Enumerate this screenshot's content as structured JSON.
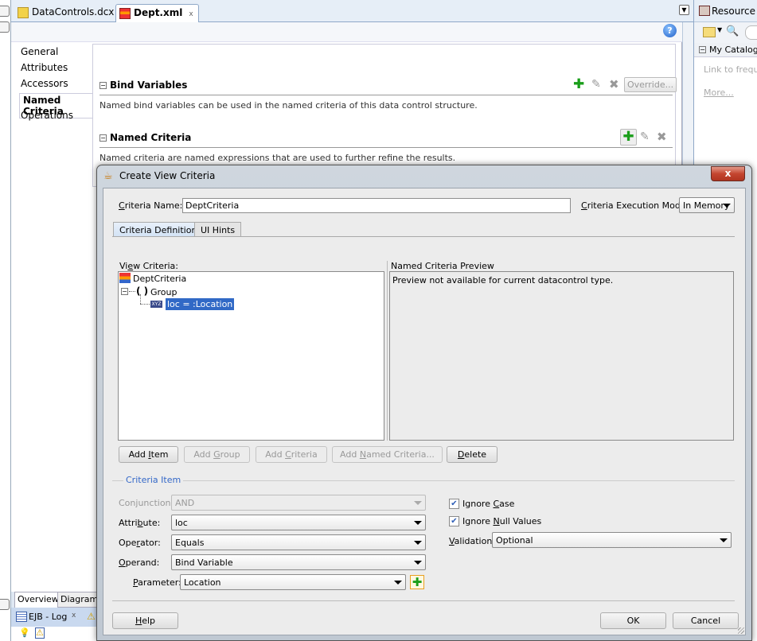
{
  "editor_tabs": [
    {
      "label": "DataControls.dcx",
      "icon": "folder-icon",
      "active": false
    },
    {
      "label": "Dept.xml",
      "icon": "xml-structure-icon",
      "active": true
    }
  ],
  "editor": {
    "nav_items": [
      "General",
      "Attributes",
      "Accessors",
      "Named Criteria",
      "Operations"
    ],
    "selected_nav": "Named Criteria",
    "sections": [
      {
        "title": "Bind Variables",
        "description": "Named bind variables can be used in the named criteria of this data control structure.",
        "override_label": "Override..."
      },
      {
        "title": "Named Criteria",
        "description": "Named criteria are named expressions that are used to further refine the results."
      }
    ],
    "help_icon": "?"
  },
  "bottom_tabs": [
    "Overview",
    "Diagram"
  ],
  "log_tab": {
    "label": "EJB - Log",
    "close": "x"
  },
  "resource_palette": {
    "title": "Resource Palette",
    "catalog_header": "My Catalogs",
    "link_text": "Link to frequently used...",
    "more_link": "More..."
  },
  "dialog": {
    "title": "Create View Criteria",
    "close_label": "x",
    "criteria_name_label": "Criteria Name:",
    "criteria_name_value": "DeptCriteria",
    "execution_mode_label": "Criteria Execution Mode:",
    "execution_mode_value": "In Memory",
    "tabs": [
      "Criteria Definition",
      "UI Hints"
    ],
    "active_tab": "Criteria Definition",
    "view_criteria_label": "View Criteria:",
    "tree": {
      "root": "DeptCriteria",
      "group": "Group",
      "item": "loc = :Location"
    },
    "preview_label": "Named Criteria Preview",
    "preview_text": "Preview not available for current datacontrol type.",
    "action_buttons": [
      {
        "label": "Add Item",
        "enabled": true
      },
      {
        "label": "Add Group",
        "enabled": false
      },
      {
        "label": "Add Criteria",
        "enabled": false
      },
      {
        "label": "Add Named Criteria...",
        "enabled": false
      },
      {
        "label": "Delete",
        "enabled": true
      }
    ],
    "criteria_item_legend": "Criteria Item",
    "conjunction_label": "Conjunction:",
    "conjunction_value": "AND",
    "attribute_label": "Attribute:",
    "attribute_value": "loc",
    "operator_label": "Operator:",
    "operator_value": "Equals",
    "operand_label": "Operand:",
    "operand_value": "Bind Variable",
    "parameter_label": "Parameter:",
    "parameter_value": "Location",
    "ignore_case_label": "Ignore Case",
    "ignore_case_checked": true,
    "ignore_null_label": "Ignore Null Values",
    "ignore_null_checked": true,
    "validation_label": "Validation:",
    "validation_value": "Optional",
    "help_label": "Help",
    "ok_label": "OK",
    "cancel_label": "Cancel"
  },
  "colors": {
    "accent_blue": "#3468c8",
    "selection": "#3169c6",
    "add_green": "#1a9e1a",
    "close_red": "#c4452f"
  }
}
